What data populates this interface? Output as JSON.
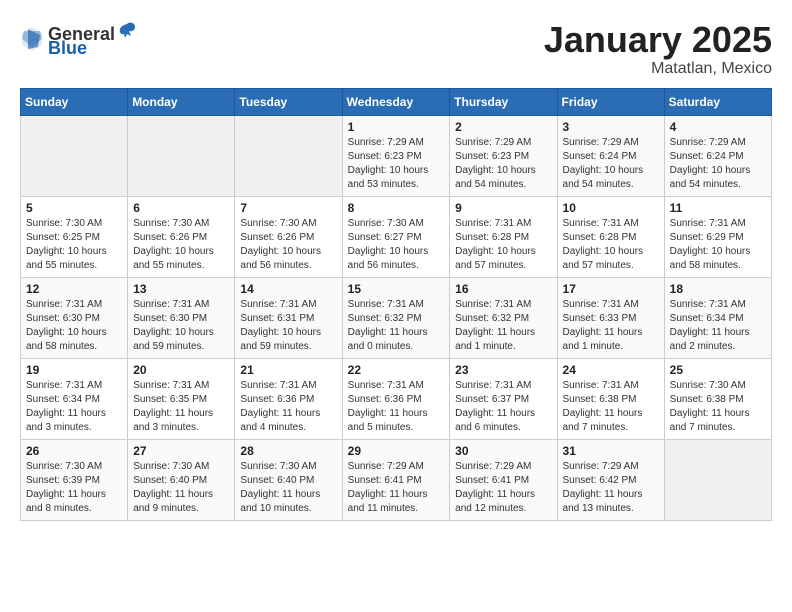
{
  "logo": {
    "general": "General",
    "blue": "Blue"
  },
  "header": {
    "title": "January 2025",
    "subtitle": "Matatlan, Mexico"
  },
  "weekdays": [
    "Sunday",
    "Monday",
    "Tuesday",
    "Wednesday",
    "Thursday",
    "Friday",
    "Saturday"
  ],
  "weeks": [
    [
      {
        "day": "",
        "info": ""
      },
      {
        "day": "",
        "info": ""
      },
      {
        "day": "",
        "info": ""
      },
      {
        "day": "1",
        "info": "Sunrise: 7:29 AM\nSunset: 6:23 PM\nDaylight: 10 hours\nand 53 minutes."
      },
      {
        "day": "2",
        "info": "Sunrise: 7:29 AM\nSunset: 6:23 PM\nDaylight: 10 hours\nand 54 minutes."
      },
      {
        "day": "3",
        "info": "Sunrise: 7:29 AM\nSunset: 6:24 PM\nDaylight: 10 hours\nand 54 minutes."
      },
      {
        "day": "4",
        "info": "Sunrise: 7:29 AM\nSunset: 6:24 PM\nDaylight: 10 hours\nand 54 minutes."
      }
    ],
    [
      {
        "day": "5",
        "info": "Sunrise: 7:30 AM\nSunset: 6:25 PM\nDaylight: 10 hours\nand 55 minutes."
      },
      {
        "day": "6",
        "info": "Sunrise: 7:30 AM\nSunset: 6:26 PM\nDaylight: 10 hours\nand 55 minutes."
      },
      {
        "day": "7",
        "info": "Sunrise: 7:30 AM\nSunset: 6:26 PM\nDaylight: 10 hours\nand 56 minutes."
      },
      {
        "day": "8",
        "info": "Sunrise: 7:30 AM\nSunset: 6:27 PM\nDaylight: 10 hours\nand 56 minutes."
      },
      {
        "day": "9",
        "info": "Sunrise: 7:31 AM\nSunset: 6:28 PM\nDaylight: 10 hours\nand 57 minutes."
      },
      {
        "day": "10",
        "info": "Sunrise: 7:31 AM\nSunset: 6:28 PM\nDaylight: 10 hours\nand 57 minutes."
      },
      {
        "day": "11",
        "info": "Sunrise: 7:31 AM\nSunset: 6:29 PM\nDaylight: 10 hours\nand 58 minutes."
      }
    ],
    [
      {
        "day": "12",
        "info": "Sunrise: 7:31 AM\nSunset: 6:30 PM\nDaylight: 10 hours\nand 58 minutes."
      },
      {
        "day": "13",
        "info": "Sunrise: 7:31 AM\nSunset: 6:30 PM\nDaylight: 10 hours\nand 59 minutes."
      },
      {
        "day": "14",
        "info": "Sunrise: 7:31 AM\nSunset: 6:31 PM\nDaylight: 10 hours\nand 59 minutes."
      },
      {
        "day": "15",
        "info": "Sunrise: 7:31 AM\nSunset: 6:32 PM\nDaylight: 11 hours\nand 0 minutes."
      },
      {
        "day": "16",
        "info": "Sunrise: 7:31 AM\nSunset: 6:32 PM\nDaylight: 11 hours\nand 1 minute."
      },
      {
        "day": "17",
        "info": "Sunrise: 7:31 AM\nSunset: 6:33 PM\nDaylight: 11 hours\nand 1 minute."
      },
      {
        "day": "18",
        "info": "Sunrise: 7:31 AM\nSunset: 6:34 PM\nDaylight: 11 hours\nand 2 minutes."
      }
    ],
    [
      {
        "day": "19",
        "info": "Sunrise: 7:31 AM\nSunset: 6:34 PM\nDaylight: 11 hours\nand 3 minutes."
      },
      {
        "day": "20",
        "info": "Sunrise: 7:31 AM\nSunset: 6:35 PM\nDaylight: 11 hours\nand 3 minutes."
      },
      {
        "day": "21",
        "info": "Sunrise: 7:31 AM\nSunset: 6:36 PM\nDaylight: 11 hours\nand 4 minutes."
      },
      {
        "day": "22",
        "info": "Sunrise: 7:31 AM\nSunset: 6:36 PM\nDaylight: 11 hours\nand 5 minutes."
      },
      {
        "day": "23",
        "info": "Sunrise: 7:31 AM\nSunset: 6:37 PM\nDaylight: 11 hours\nand 6 minutes."
      },
      {
        "day": "24",
        "info": "Sunrise: 7:31 AM\nSunset: 6:38 PM\nDaylight: 11 hours\nand 7 minutes."
      },
      {
        "day": "25",
        "info": "Sunrise: 7:30 AM\nSunset: 6:38 PM\nDaylight: 11 hours\nand 7 minutes."
      }
    ],
    [
      {
        "day": "26",
        "info": "Sunrise: 7:30 AM\nSunset: 6:39 PM\nDaylight: 11 hours\nand 8 minutes."
      },
      {
        "day": "27",
        "info": "Sunrise: 7:30 AM\nSunset: 6:40 PM\nDaylight: 11 hours\nand 9 minutes."
      },
      {
        "day": "28",
        "info": "Sunrise: 7:30 AM\nSunset: 6:40 PM\nDaylight: 11 hours\nand 10 minutes."
      },
      {
        "day": "29",
        "info": "Sunrise: 7:29 AM\nSunset: 6:41 PM\nDaylight: 11 hours\nand 11 minutes."
      },
      {
        "day": "30",
        "info": "Sunrise: 7:29 AM\nSunset: 6:41 PM\nDaylight: 11 hours\nand 12 minutes."
      },
      {
        "day": "31",
        "info": "Sunrise: 7:29 AM\nSunset: 6:42 PM\nDaylight: 11 hours\nand 13 minutes."
      },
      {
        "day": "",
        "info": ""
      }
    ]
  ]
}
